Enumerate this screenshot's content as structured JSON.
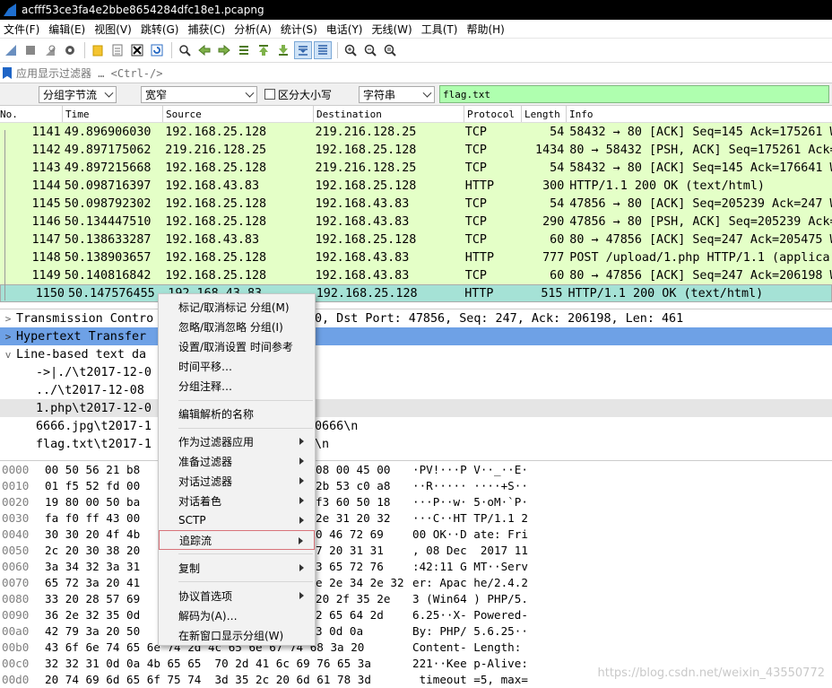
{
  "window": {
    "title": "acfff53ce3fa4e2bbe8654284dfc18e1.pcapng"
  },
  "menu": [
    "文件(F)",
    "编辑(E)",
    "视图(V)",
    "跳转(G)",
    "捕获(C)",
    "分析(A)",
    "统计(S)",
    "电话(Y)",
    "无线(W)",
    "工具(T)",
    "帮助(H)"
  ],
  "toolbar_icons": [
    "shark-fin-start-icon",
    "stop-icon",
    "restart-icon",
    "options-gear-icon",
    "open-file-icon",
    "file-set-icon",
    "close-file-icon",
    "reload-icon",
    "find-icon",
    "go-back-icon",
    "go-forward-icon",
    "go-to-packet-icon",
    "first-packet-icon",
    "last-packet-icon",
    "autoscroll-icon",
    "colorize-icon",
    "zoom-in-icon",
    "zoom-out-icon",
    "normal-size-icon"
  ],
  "filter": {
    "placeholder": "应用显示过滤器 … <Ctrl-/>"
  },
  "find": {
    "scope": "分组字节流",
    "width": "宽窄",
    "case_label": "区分大小写",
    "type": "字符串",
    "query": "flag.txt"
  },
  "columns": [
    "No.",
    "Time",
    "Source",
    "Destination",
    "Protocol",
    "Length",
    "Info"
  ],
  "packets": [
    {
      "no": "1141",
      "time": "49.896906030",
      "src": "192.168.25.128",
      "dst": "219.216.128.25",
      "proto": "TCP",
      "len": "54",
      "info": "58432 → 80 [ACK] Seq=145 Ack=175261 W"
    },
    {
      "no": "1142",
      "time": "49.897175062",
      "src": "219.216.128.25",
      "dst": "192.168.25.128",
      "proto": "TCP",
      "len": "1434",
      "info": "80 → 58432 [PSH, ACK] Seq=175261 Ack="
    },
    {
      "no": "1143",
      "time": "49.897215668",
      "src": "192.168.25.128",
      "dst": "219.216.128.25",
      "proto": "TCP",
      "len": "54",
      "info": "58432 → 80 [ACK] Seq=145 Ack=176641 W"
    },
    {
      "no": "1144",
      "time": "50.098716397",
      "src": "192.168.43.83",
      "dst": "192.168.25.128",
      "proto": "HTTP",
      "len": "300",
      "info": "HTTP/1.1 200 OK  (text/html)"
    },
    {
      "no": "1145",
      "time": "50.098792302",
      "src": "192.168.25.128",
      "dst": "192.168.43.83",
      "proto": "TCP",
      "len": "54",
      "info": "47856 → 80 [ACK] Seq=205239 Ack=247 W"
    },
    {
      "no": "1146",
      "time": "50.134447510",
      "src": "192.168.25.128",
      "dst": "192.168.43.83",
      "proto": "TCP",
      "len": "290",
      "info": "47856 → 80 [PSH, ACK] Seq=205239 Ack="
    },
    {
      "no": "1147",
      "time": "50.138633287",
      "src": "192.168.43.83",
      "dst": "192.168.25.128",
      "proto": "TCP",
      "len": "60",
      "info": "80 → 47856 [ACK] Seq=247 Ack=205475 W"
    },
    {
      "no": "1148",
      "time": "50.138903657",
      "src": "192.168.25.128",
      "dst": "192.168.43.83",
      "proto": "HTTP",
      "len": "777",
      "info": "POST /upload/1.php HTTP/1.1  (applica"
    },
    {
      "no": "1149",
      "time": "50.140816842",
      "src": "192.168.25.128",
      "dst": "192.168.43.83",
      "proto": "TCP",
      "len": "60",
      "info": "80 → 47856 [ACK] Seq=247 Ack=206198 W"
    },
    {
      "no": "1150",
      "time": "50.147576455",
      "src": "192.168.43.83",
      "dst": "192.168.25.128",
      "proto": "HTTP",
      "len": "515",
      "info": "HTTP/1.1 200 OK  (text/html)"
    }
  ],
  "details": [
    {
      "toggle": ">",
      "text": "Transmission Contro",
      "tail": "0, Dst Port: 47856, Seq: 247, Ack: 206198, Len: 461"
    },
    {
      "toggle": ">",
      "text": "Hypertext Transfer",
      "tail": ""
    },
    {
      "toggle": "v",
      "text": "Line-based text da",
      "tail": ""
    },
    {
      "toggle": "",
      "text": "->|./\\t2017-12-0",
      "tail": ""
    },
    {
      "toggle": "",
      "text": "../\\t2017-12-08",
      "tail": ""
    },
    {
      "toggle": "",
      "text": "1.php\\t2017-12-0",
      "tail": ""
    },
    {
      "toggle": "",
      "text": "6666.jpg\\t2017-1",
      "tail": "0666\\n"
    },
    {
      "toggle": "",
      "text": "flag.txt\\t2017-1",
      "tail": "\\n"
    }
  ],
  "hex": [
    {
      "off": "0000",
      "a": "00 50 56 21 b8",
      "b": "08 00 45 00",
      "asc1": "·PV!···P",
      "asc2": "V··_··E·"
    },
    {
      "off": "0010",
      "a": "01 f5 52 fd 00",
      "b": "2b 53 c0 a8",
      "asc1": "··R·····",
      "asc2": "····+S··"
    },
    {
      "off": "0020",
      "a": "19 80 00 50 ba",
      "b": "f3 60 50 18",
      "asc1": "···P··w·",
      "asc2": "5·oM·`P·"
    },
    {
      "off": "0030",
      "a": "fa f0 ff 43 00",
      "b": "2e 31 20 32",
      "asc1": "···C··HT",
      "asc2": "TP/1.1 2"
    },
    {
      "off": "0040",
      "a": "30 30 20 4f 4b",
      "b": "0 46 72 69",
      "asc1": "00 OK··D",
      "asc2": "ate: Fri"
    },
    {
      "off": "0050",
      "a": "2c 20 30 38 20",
      "b": "7 20 31 31",
      "asc1": ", 08 Dec",
      "asc2": " 2017 11"
    },
    {
      "off": "0060",
      "a": "3a 34 32 3a 31",
      "b": "3 65 72 76",
      "asc1": ":42:11 G",
      "asc2": "MT··Serv"
    },
    {
      "off": "0070",
      "a": "65 72 3a 20 41",
      "b": "e 2e 34 2e 32",
      "asc1": "er: Apac",
      "asc2": "he/2.4.2"
    },
    {
      "off": "0080",
      "a": "33 20 28 57 69",
      "b": "20 2f 35 2e",
      "asc1": "3 (Win64",
      "asc2": ") PHP/5."
    },
    {
      "off": "0090",
      "a": "36 2e 32 35 0d",
      "b": "2 65 64 2d",
      "asc1": "6.25··X-",
      "asc2": "Powered-"
    },
    {
      "off": "00a0",
      "a": "42 79 3a 20 50",
      "b": "3 0d 0a",
      "asc1": "By: PHP/",
      "asc2": "5.6.25··"
    },
    {
      "off": "00b0",
      "a": "43 6f 6e 74 65 6e 74 2d 4c 65 6e 67 74 68 3a 20",
      "b": "",
      "asc1": "Content-",
      "asc2": "Length: "
    },
    {
      "off": "00c0",
      "a": "32 32 31 0d 0a 4b 65 65  70 2d 41 6c 69 76 65 3a",
      "b": "",
      "asc1": "221··Kee",
      "asc2": "p-Alive:"
    },
    {
      "off": "00d0",
      "a": "20 74 69 6d 65 6f 75 74  3d 35 2c 20 6d 61 78 3d",
      "b": "",
      "asc1": " timeout",
      "asc2": "=5, max="
    }
  ],
  "context_menu": [
    {
      "label": "标记/取消标记 分组(M)",
      "sub": false
    },
    {
      "label": "忽略/取消忽略 分组(I)",
      "sub": false
    },
    {
      "label": "设置/取消设置 时间参考",
      "sub": false
    },
    {
      "label": "时间平移…",
      "sub": false
    },
    {
      "label": "分组注释…",
      "sub": false
    },
    {
      "label": "编辑解析的名称",
      "sub": false
    },
    {
      "label": "作为过滤器应用",
      "sub": true
    },
    {
      "label": "准备过滤器",
      "sub": true
    },
    {
      "label": "对话过滤器",
      "sub": true
    },
    {
      "label": "对话着色",
      "sub": true
    },
    {
      "label": "SCTP",
      "sub": true
    },
    {
      "label": "追踪流",
      "sub": true
    },
    {
      "label": "复制",
      "sub": true
    },
    {
      "label": "协议首选项",
      "sub": true
    },
    {
      "label": "解码为(A)…",
      "sub": false
    },
    {
      "label": "在新窗口显示分组(W)",
      "sub": false
    }
  ],
  "watermark": "https://blog.csdn.net/weixin_43550772",
  "colors": {
    "tcp_row": "#e4ffc7",
    "selected_row": "#a5e2d6",
    "detail_highlight": "#6ea1e6",
    "search_field": "#afffaf"
  }
}
